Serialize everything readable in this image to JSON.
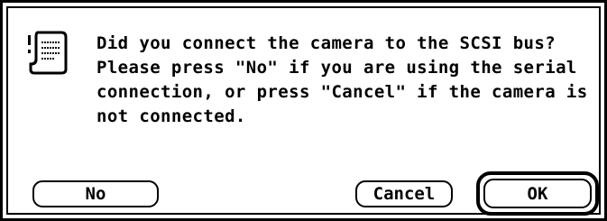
{
  "dialog": {
    "icon": "note-icon",
    "message": "Did you connect the camera to the SCSI bus?\nPlease press \"No\" if you are using the serial\nconnection, or press \"Cancel\" if the camera is\nnot connected.",
    "buttons": {
      "no_label": "No",
      "cancel_label": "Cancel",
      "ok_label": "OK",
      "default": "OK"
    }
  },
  "colors": {
    "background": "#ffffff",
    "foreground": "#000000"
  }
}
